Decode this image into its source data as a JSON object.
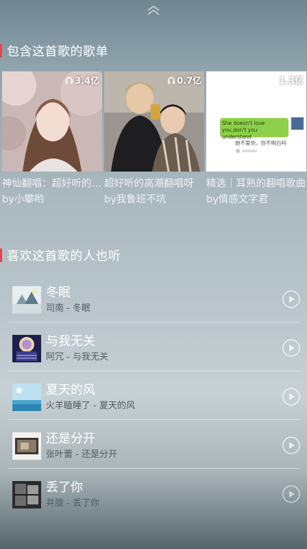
{
  "sections": {
    "playlists_title": "包含这首歌的歌单",
    "similar_title": "喜欢这首歌的人也听"
  },
  "playlists": [
    {
      "play_count": "3.4亿",
      "name": "神仙翻唱：超好听的翻唱",
      "by": "by小攀哟"
    },
    {
      "play_count": "0.7亿",
      "name": "超好听的高潮翻唱呀",
      "by": "by我鲁班不坑"
    },
    {
      "play_count": "1.3亿",
      "name": "精选｜耳熟的翻唱歌曲",
      "by": "by情感文字君",
      "cover_text": {
        "bubble_en": "She doesn't love you,don't you understand",
        "caption": "她不爱你，你不明白吗"
      }
    }
  ],
  "songs": [
    {
      "title": "冬眠",
      "subtitle": "司南 - 冬眠"
    },
    {
      "title": "与我无关",
      "subtitle": "阿冗 - 与我无关"
    },
    {
      "title": "夏天的风",
      "subtitle": "火羊瞌睡了 - 夏天的风"
    },
    {
      "title": "还是分开",
      "subtitle": "张叶蕾 - 还是分开"
    },
    {
      "title": "丢了你",
      "subtitle": "井胧 - 丢了你"
    }
  ],
  "colors": {
    "accent": "#e8434b",
    "subtitle": "#4f5b61"
  },
  "icons": {
    "collapse": "chevron-up-icon",
    "play": "play-circle-icon",
    "listen": "headphones-icon"
  }
}
